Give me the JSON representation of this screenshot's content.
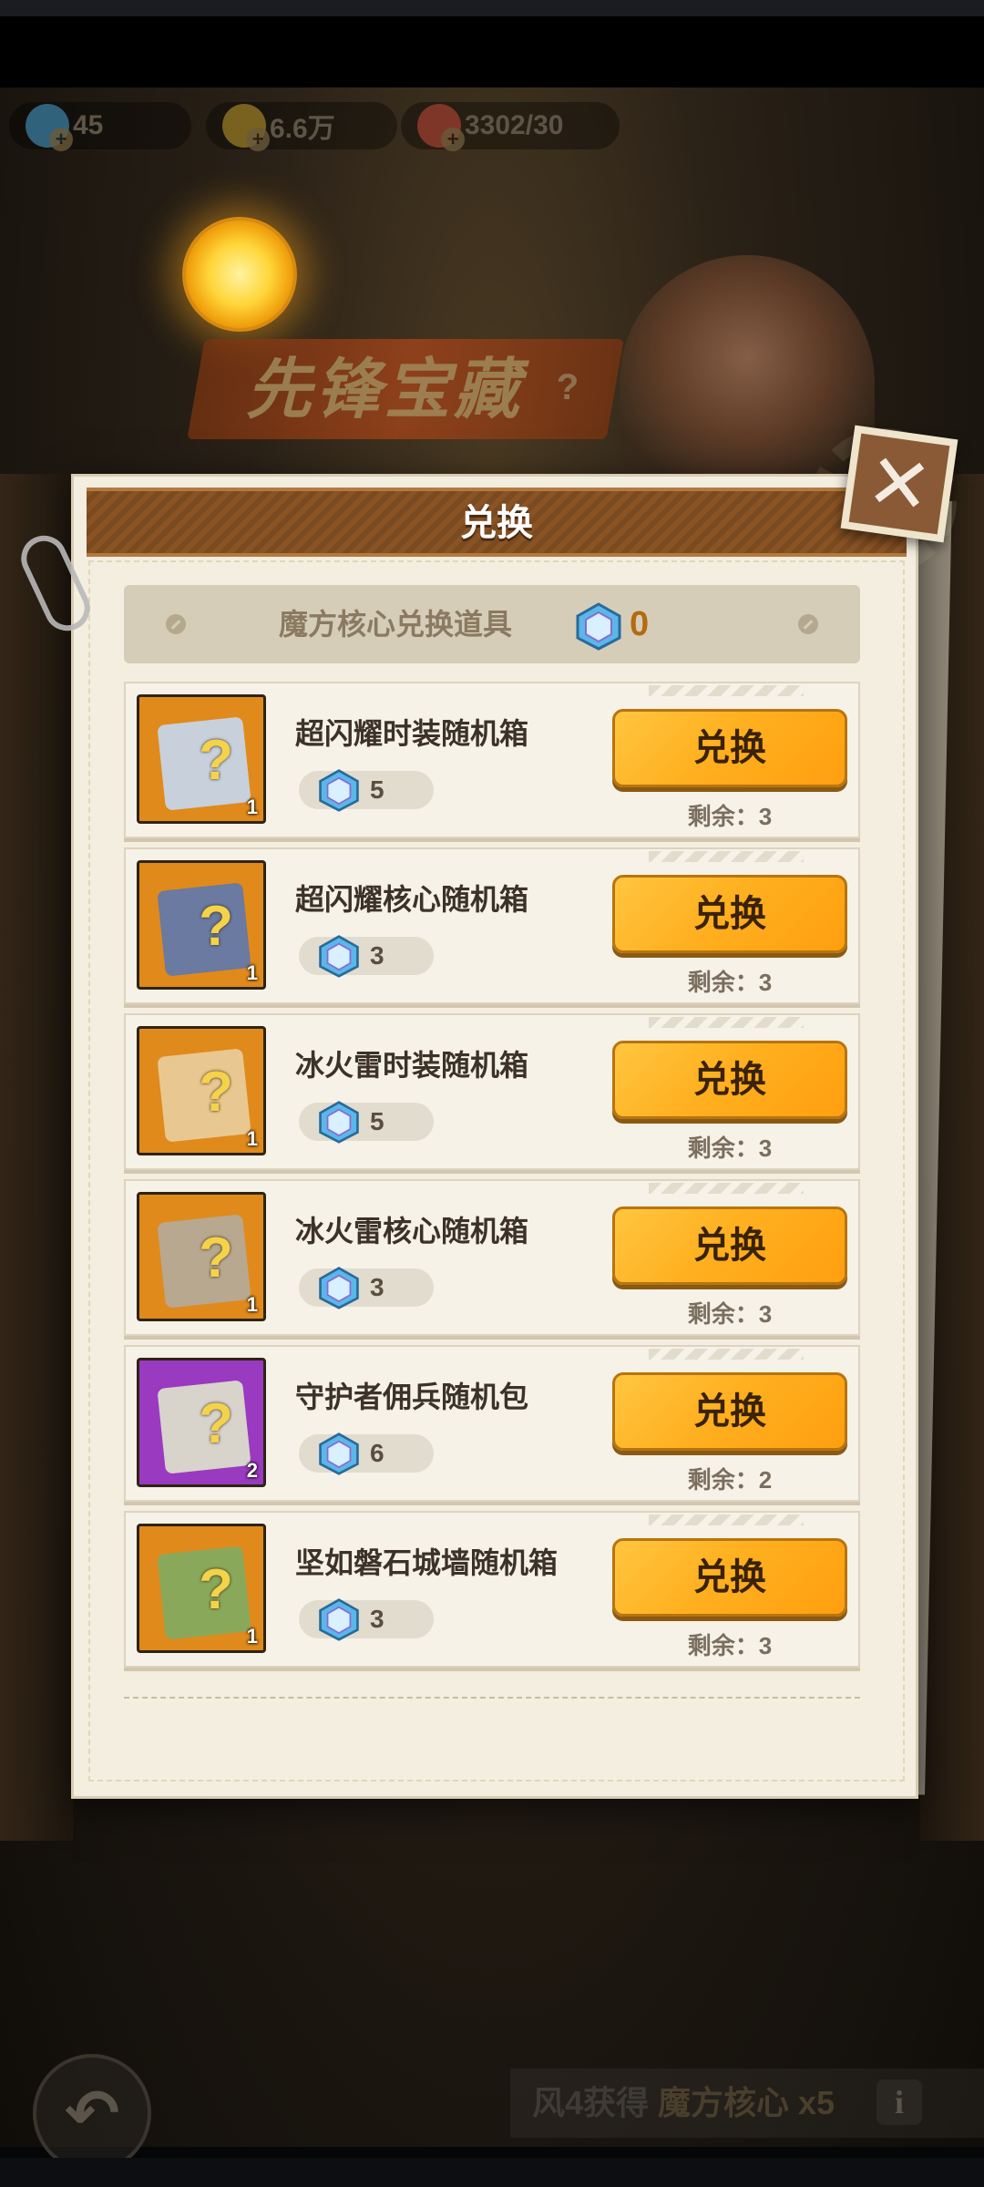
{
  "resources": [
    {
      "icon": "gem-icon",
      "value": "45",
      "color": "#4aa8d8"
    },
    {
      "icon": "coin-icon",
      "value": "6.6万",
      "color": "#c8a030"
    },
    {
      "icon": "meat-icon",
      "value": "3302/30",
      "color": "#c84a3a"
    }
  ],
  "banner": {
    "title": "先锋宝藏"
  },
  "dialog": {
    "title": "兑换",
    "close_icon": "close-icon"
  },
  "currency": {
    "label": "魔方核心兑换道具",
    "count": "0",
    "icon": "cube-core-icon"
  },
  "items": [
    {
      "name": "超闪耀时装随机箱",
      "cost": "5",
      "qty": "1",
      "button": "兑换",
      "remaining": "剩余：3",
      "bg": "#e08a1c",
      "box": "#c8d0dc"
    },
    {
      "name": "超闪耀核心随机箱",
      "cost": "3",
      "qty": "1",
      "button": "兑换",
      "remaining": "剩余：3",
      "bg": "#e08a1c",
      "box": "#6a7aa0"
    },
    {
      "name": "冰火雷时装随机箱",
      "cost": "5",
      "qty": "1",
      "button": "兑换",
      "remaining": "剩余：3",
      "bg": "#e08a1c",
      "box": "#e8c890"
    },
    {
      "name": "冰火雷核心随机箱",
      "cost": "3",
      "qty": "1",
      "button": "兑换",
      "remaining": "剩余：3",
      "bg": "#e08a1c",
      "box": "#b8a890"
    },
    {
      "name": "守护者佣兵随机包",
      "cost": "6",
      "qty": "2",
      "button": "兑换",
      "remaining": "剩余：2",
      "bg": "#9a3ac0",
      "box": "#d8d4cc"
    },
    {
      "name": "坚如磐石城墙随机箱",
      "cost": "3",
      "qty": "1",
      "button": "兑换",
      "remaining": "剩余：3",
      "bg": "#e08a1c",
      "box": "#8aa85a"
    }
  ],
  "bottom": {
    "hint_prefix": "风4获得",
    "hint_item": "魔方核心 x5",
    "back_icon": "back-arrow-icon",
    "info_icon": "info-icon"
  },
  "colors": {
    "accent_button": "#ffb020",
    "dialog_bg": "#f4eee0",
    "header": "#8a5324"
  }
}
